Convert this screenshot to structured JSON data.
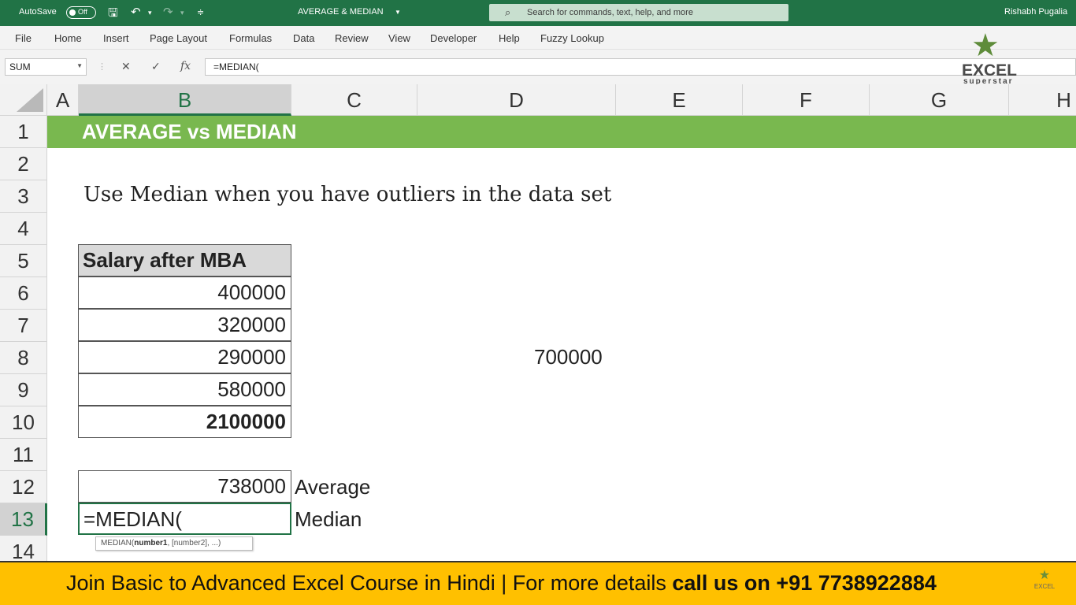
{
  "titlebar": {
    "autosave_label": "AutoSave",
    "autosave_state": "Off",
    "doc_title": "AVERAGE & MEDIAN",
    "search_placeholder": "Search for commands, text, help, and more",
    "user": "Rishabh Pugalia"
  },
  "menu": [
    "File",
    "Home",
    "Insert",
    "Page Layout",
    "Formulas",
    "Data",
    "Review",
    "View",
    "Developer",
    "Help",
    "Fuzzy Lookup"
  ],
  "formula_bar": {
    "name_box": "SUM",
    "cancel": "✕",
    "enter": "✓",
    "fx": "fx",
    "formula": "=MEDIAN("
  },
  "logo": {
    "line1": "EXCEL",
    "line2": "superstar"
  },
  "grid": {
    "columns": [
      "A",
      "B",
      "C",
      "D",
      "E",
      "F",
      "G",
      "H"
    ],
    "rows": [
      "1",
      "2",
      "3",
      "4",
      "5",
      "6",
      "7",
      "8",
      "9",
      "10",
      "11",
      "12",
      "13",
      "14"
    ],
    "selected_column": "B",
    "selected_row": "13",
    "banner": "AVERAGE vs MEDIAN",
    "note": "Use Median when you have outliers in the data set",
    "table_header": "Salary after MBA",
    "values": [
      "400000",
      "320000",
      "290000",
      "580000",
      "2100000"
    ],
    "side_value": "700000",
    "average_value": "738000",
    "average_label": "Average",
    "editing_cell": "=MEDIAN(",
    "median_label": "Median",
    "tooltip_fn": "MEDIAN(",
    "tooltip_arg1": "number1",
    "tooltip_rest": ", [number2], ...)"
  },
  "footer": {
    "text_normal": "Join Basic to Advanced Excel Course in Hindi | For more details ",
    "text_bold": "call us on +91 7738922884",
    "mini_logo": "EXCEL"
  }
}
